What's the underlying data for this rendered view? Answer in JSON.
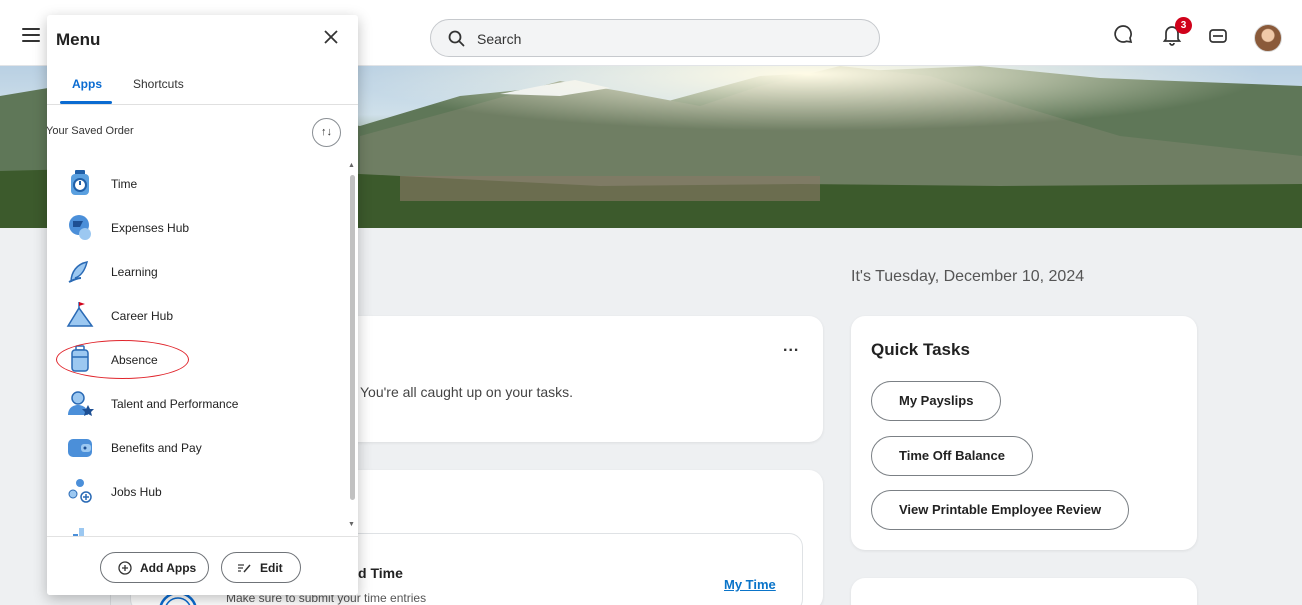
{
  "header": {
    "search_placeholder": "Search",
    "notification_count": "3"
  },
  "menu": {
    "title": "Menu",
    "tabs": [
      "Apps",
      "Shortcuts"
    ],
    "active_tab": "Apps",
    "section_label": "Your Saved Order",
    "apps": [
      {
        "label": "Time",
        "icon": "stopwatch-icon"
      },
      {
        "label": "Expenses Hub",
        "icon": "expenses-icon"
      },
      {
        "label": "Learning",
        "icon": "learning-icon"
      },
      {
        "label": "Career Hub",
        "icon": "mountain-flag-icon"
      },
      {
        "label": "Absence",
        "icon": "suitcase-icon"
      },
      {
        "label": "Talent and Performance",
        "icon": "person-star-icon"
      },
      {
        "label": "Benefits and Pay",
        "icon": "wallet-icon"
      },
      {
        "label": "Jobs Hub",
        "icon": "people-plus-icon"
      }
    ],
    "add_apps_label": "Add Apps",
    "edit_label": "Edit"
  },
  "main": {
    "date_text": "It's Tuesday, December 10, 2024",
    "tasks_message": "You're all caught up on your tasks.",
    "more_label": "...",
    "time_card": {
      "title": "d Time",
      "subtitle": "Make sure to submit your time entries",
      "link": "My Time"
    }
  },
  "quick_tasks": {
    "title": "Quick Tasks",
    "buttons": [
      "My Payslips",
      "Time Off Balance",
      "View Printable Employee Review"
    ]
  },
  "colors": {
    "accent": "#0a6bd1",
    "badge": "#d0021b",
    "highlight_ring": "#e0242b"
  }
}
